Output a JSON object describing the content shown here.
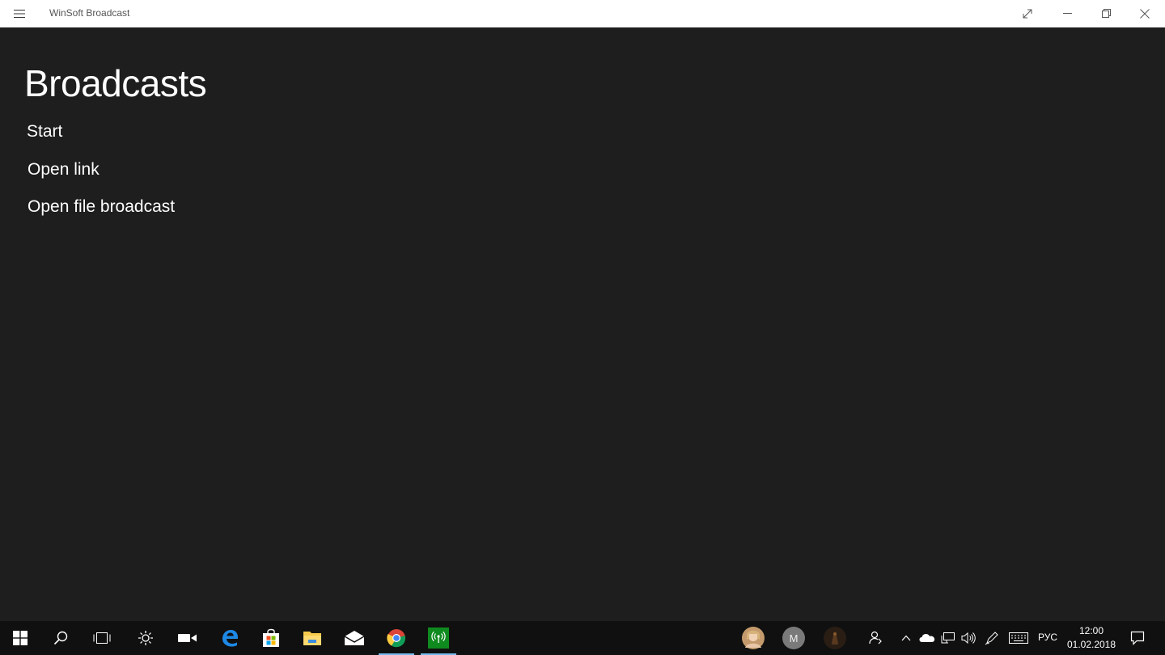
{
  "window": {
    "app_title": "WinSoft Broadcast",
    "icons": {
      "menu": "hamburger-icon",
      "expand": "expand-icon",
      "minimize": "minimize-icon",
      "restore": "restore-icon",
      "close": "close-icon"
    }
  },
  "page": {
    "title": "Broadcasts",
    "nav": [
      {
        "label": "Start"
      },
      {
        "label": "Open link"
      },
      {
        "label": "Open file broadcast"
      }
    ]
  },
  "taskbar": {
    "apps": [
      {
        "name": "start-icon"
      },
      {
        "name": "search-icon"
      },
      {
        "name": "task-view-icon"
      },
      {
        "name": "brightness-icon"
      },
      {
        "name": "camera-icon"
      },
      {
        "name": "edge-icon"
      },
      {
        "name": "store-icon"
      },
      {
        "name": "file-explorer-icon"
      },
      {
        "name": "mail-icon"
      },
      {
        "name": "chrome-icon"
      },
      {
        "name": "broadcast-app-icon"
      }
    ],
    "tray": {
      "avatar_initial": "M",
      "language": "РУС",
      "time": "12:00",
      "date": "01.02.2018"
    }
  },
  "colors": {
    "background": "#1e1e1e",
    "titlebar": "#ffffff",
    "taskbar": "#101010",
    "accent": "#76b9ed",
    "broadcast_green": "#0f8a1e"
  }
}
